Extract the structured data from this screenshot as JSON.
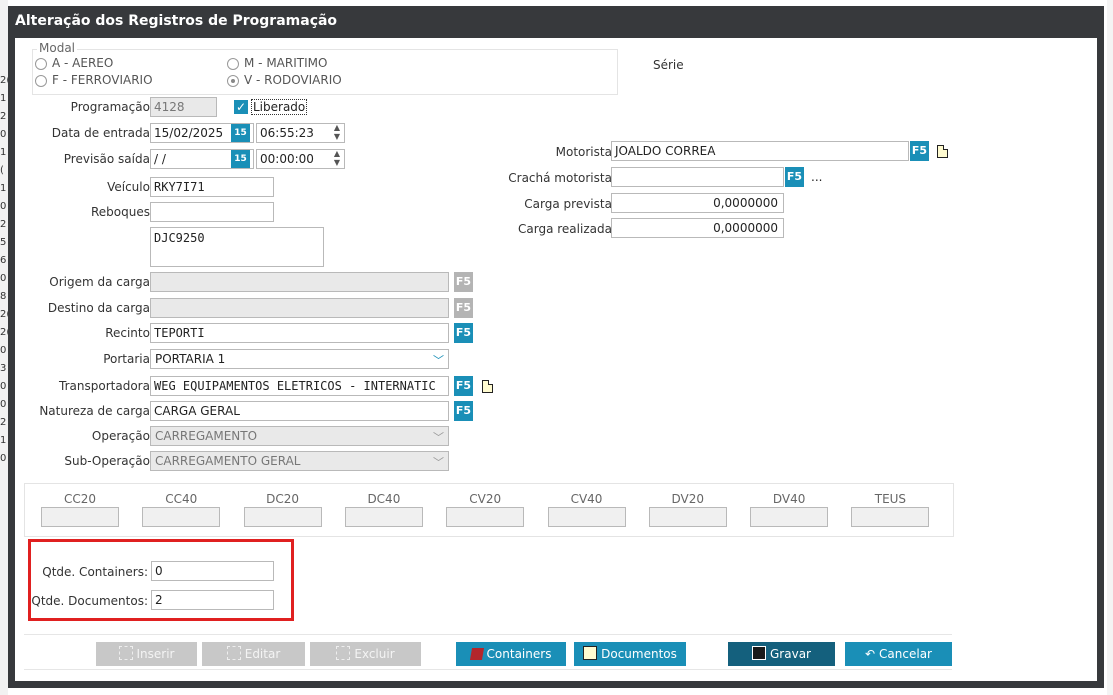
{
  "background": {
    "left_fragments": [
      "2(",
      "1",
      "2",
      "0",
      "1",
      "(",
      "1",
      "0",
      "2",
      "5",
      "6",
      "0",
      "8",
      "2(",
      "2(",
      "0",
      "3",
      "0",
      "0",
      "2",
      "1",
      "0"
    ],
    "right_fragments": [
      "¨"
    ]
  },
  "window": {
    "title": "Alteração dos Registros de Programação"
  },
  "modal": {
    "label": "Modal",
    "options": [
      "A - AEREO",
      "F - FERROVIARIO",
      "M - MARITIMO",
      "V - RODOVIARIO"
    ],
    "selected": "V - RODOVIARIO"
  },
  "serie": {
    "label": "Série"
  },
  "form": {
    "programacao": {
      "label": "Programação:",
      "value": "4128"
    },
    "liberado": {
      "label": "Liberado",
      "checked": true
    },
    "data_entrada": {
      "label": "Data de entrada:",
      "date": "15/02/2025",
      "time": "06:55:23"
    },
    "previsao_saida": {
      "label": "Previsão saída:",
      "date": " / /",
      "time": "00:00:00"
    },
    "calendar_icon": "15",
    "veiculo": {
      "label": "Veículo:",
      "value": "RKY7I71"
    },
    "reboques": {
      "label": "Reboques:",
      "value": "",
      "list": "DJC9250"
    },
    "origem": {
      "label": "Origem da carga:",
      "value": ""
    },
    "destino": {
      "label": "Destino da carga:",
      "value": ""
    },
    "recinto": {
      "label": "Recinto:",
      "value": "TEPORTI"
    },
    "portaria": {
      "label": "Portaria:",
      "value": "PORTARIA 1"
    },
    "transportadora": {
      "label": "Transportadora:",
      "value": "WEG EQUIPAMENTOS ELETRICOS - INTERNATIC"
    },
    "natureza": {
      "label": "Natureza de carga:",
      "value": "CARGA GERAL"
    },
    "operacao": {
      "label": "Operação:",
      "value": "CARREGAMENTO"
    },
    "sub_operacao": {
      "label": "Sub-Operação:",
      "value": "CARREGAMENTO GERAL"
    },
    "motorista": {
      "label": "Motorista:",
      "value": "JOALDO CORREA"
    },
    "cracha": {
      "label": "Crachá motorista:",
      "value": "",
      "more": "..."
    },
    "carga_prevista": {
      "label": "Carga prevista:",
      "value": "0,0000000"
    },
    "carga_realizada": {
      "label": "Carga realizada:",
      "value": "0,0000000"
    },
    "f5_label": "F5"
  },
  "containers": {
    "headers": [
      "CC20",
      "CC40",
      "DC20",
      "DC40",
      "CV20",
      "CV40",
      "DV20",
      "DV40",
      "TEUS"
    ]
  },
  "qtde": {
    "containers": {
      "label": "Qtde. Containers:",
      "value": "0"
    },
    "documentos": {
      "label": "Qtde. Documentos:",
      "value": "2"
    },
    "highlight_color": "#e02020"
  },
  "buttons": {
    "inserir": "Inserir",
    "editar": "Editar",
    "excluir": "Excluir",
    "containers": "Containers",
    "documentos": "Documentos",
    "gravar": "Gravar",
    "cancelar": "Cancelar"
  },
  "colors": {
    "accent": "#1a8fb7",
    "title_bar": "#37393c",
    "save_button": "#14607d"
  }
}
